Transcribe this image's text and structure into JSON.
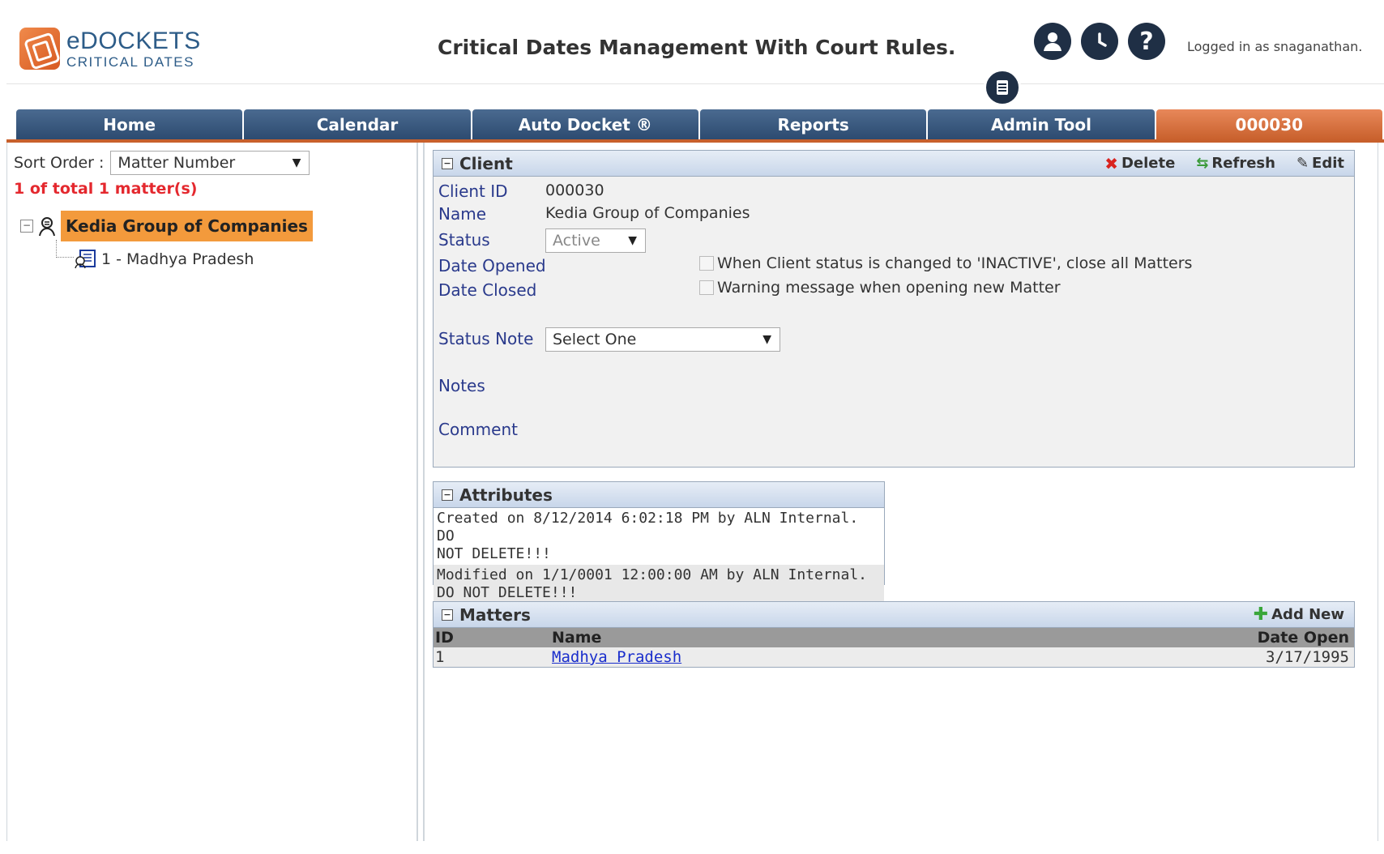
{
  "header": {
    "logo_title": "eDOCKETS",
    "logo_subtitle": "CRITICAL DATES",
    "app_title": "Critical Dates Management With Court Rules.",
    "logged_in_text": "Logged in as snaganathan."
  },
  "nav": {
    "tabs": [
      {
        "label": "Home"
      },
      {
        "label": "Calendar"
      },
      {
        "label": "Auto Docket ®"
      },
      {
        "label": "Reports"
      },
      {
        "label": "Admin Tool"
      },
      {
        "label": "000030",
        "active": true
      }
    ]
  },
  "left": {
    "sort_label": "Sort Order :",
    "sort_value": "Matter Number",
    "count_text": "1 of total 1 matter(s)",
    "tree": {
      "root_label": "Kedia Group of Companies",
      "child_label": "1 - Madhya Pradesh"
    }
  },
  "client_panel": {
    "title": "Client",
    "actions": {
      "delete": "Delete",
      "refresh": "Refresh",
      "edit": "Edit"
    },
    "labels": {
      "client_id": "Client ID",
      "name": "Name",
      "status": "Status",
      "date_opened": "Date Opened",
      "date_closed": "Date Closed",
      "status_note": "Status Note",
      "notes": "Notes",
      "comment": "Comment"
    },
    "values": {
      "client_id": "000030",
      "name": "Kedia Group of Companies",
      "status": "Active",
      "status_note": "Select One"
    },
    "checkboxes": {
      "close_all": "When Client status is changed to 'INACTIVE', close all Matters",
      "warning": "Warning message when opening new Matter"
    }
  },
  "attributes_panel": {
    "title": "Attributes",
    "lines": [
      "Created on 8/12/2014 6:02:18 PM by ALN Internal. DO",
      "NOT DELETE!!!",
      "Modified on 1/1/0001 12:00:00 AM by ALN Internal.",
      "DO NOT DELETE!!!"
    ]
  },
  "matters_panel": {
    "title": "Matters",
    "add_new": "Add New",
    "columns": {
      "id": "ID",
      "name": "Name",
      "date_open": "Date Open"
    },
    "rows": [
      {
        "id": "1",
        "name": "Madhya Pradesh",
        "date_open": "3/17/1995"
      }
    ]
  },
  "colors": {
    "nav_blue": "#2c4a6f",
    "nav_orange": "#c8602c",
    "tree_highlight": "#f39a3c",
    "count_red": "#e4282e",
    "label_blue": "#2a3a8c"
  }
}
